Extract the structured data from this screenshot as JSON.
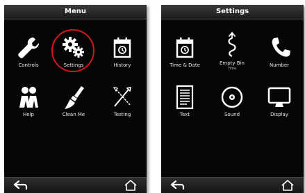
{
  "menu_screen": {
    "title": "Menu",
    "items": [
      {
        "label": "Controls",
        "icon": "wrench-icon"
      },
      {
        "label": "Settings",
        "icon": "gears-icon"
      },
      {
        "label": "History",
        "icon": "calendar-icon"
      },
      {
        "label": "Help",
        "icon": "people-icon"
      },
      {
        "label": "Clean Me",
        "icon": "brush-icon"
      },
      {
        "label": "Testing",
        "icon": "tools-icon"
      }
    ],
    "highlight_color": "#d8161b"
  },
  "settings_screen": {
    "title": "Settings",
    "items": [
      {
        "label": "Time & Date",
        "icon": "calendar-clock-icon"
      },
      {
        "label": "Empty Bin",
        "sublabel": "Time",
        "icon": "empty-bin-icon"
      },
      {
        "label": "Number",
        "icon": "phone-icon"
      },
      {
        "label": "Text",
        "icon": "document-icon"
      },
      {
        "label": "Sound",
        "icon": "speaker-icon"
      },
      {
        "label": "Display",
        "icon": "monitor-icon"
      }
    ]
  },
  "navigation": {
    "back_icon": "back-arrow-icon",
    "home_icon": "home-icon"
  }
}
